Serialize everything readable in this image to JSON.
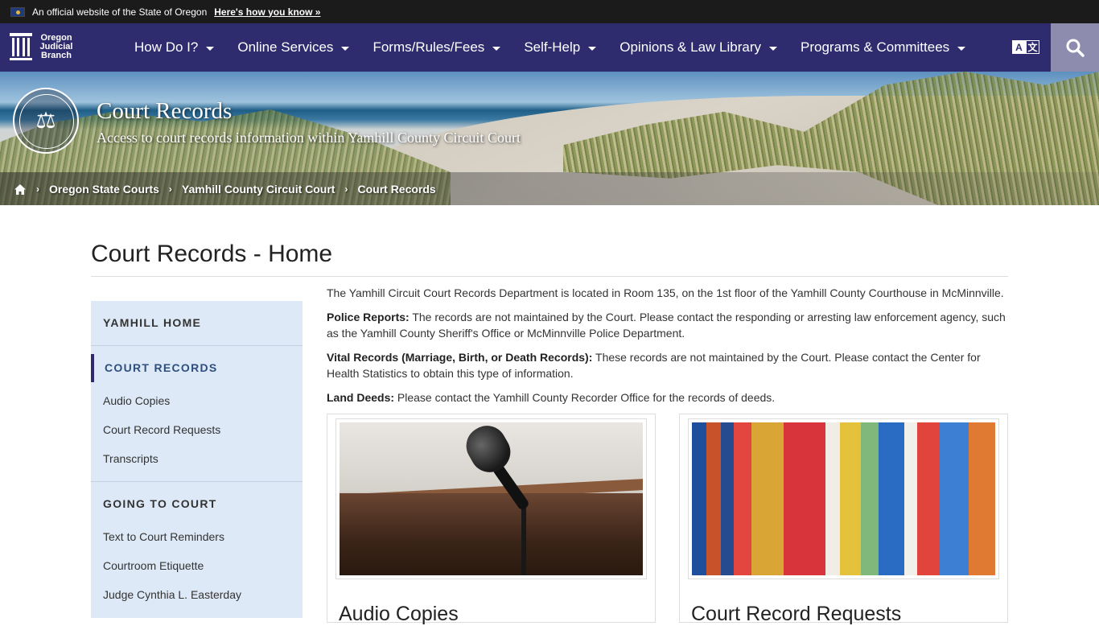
{
  "official_banner": {
    "text": "An official website of the State of Oregon",
    "link": "Here's how you know »"
  },
  "navbar": {
    "logo_lines": [
      "Oregon",
      "Judicial",
      "Branch"
    ],
    "items": [
      {
        "label": "How Do I?"
      },
      {
        "label": "Online Services"
      },
      {
        "label": "Forms/Rules/Fees"
      },
      {
        "label": "Self-Help"
      },
      {
        "label": "Opinions & Law Library"
      },
      {
        "label": "Programs & Committees"
      }
    ],
    "translate_glyphs": [
      "A",
      "文"
    ]
  },
  "hero": {
    "seal_symbol": "⚖",
    "title": "Court Records",
    "subtitle": "Access to court records information within Yamhill County Circuit Court",
    "breadcrumb": [
      "Oregon State Courts",
      "Yamhill County Circuit Court",
      "Court Records"
    ]
  },
  "page": {
    "title": "Court Records - Home"
  },
  "sidebar": {
    "sections": [
      {
        "heading": "YAMHILL HOME",
        "links": []
      },
      {
        "heading": "COURT RECORDS",
        "active": true,
        "links": [
          "Audio Copies",
          "Court Record Requests",
          "Transcripts"
        ]
      },
      {
        "heading": "GOING TO COURT",
        "links": [
          "Text to Court Reminders",
          "Courtroom Etiquette",
          "Judge Cynthia L. Easterday"
        ]
      }
    ]
  },
  "main": {
    "intro": "The Yamhill Circuit Court Records Department is located in Room 135, on the 1st floor of the Yamhill County Courthouse in McMinnville.",
    "police": {
      "label": "Police Reports:",
      "text": " The records are not maintained by the Court. Please contact the responding or arresting law enforcement agency, such as the Yamhill County Sheriff's Office or McMinnville Police Department."
    },
    "vital": {
      "label": "Vital Records (Marriage, Birth, or Death Records):",
      "text": " These records are not maintained by the Court. Please contact the Center for Health Statistics to obtain this type of information."
    },
    "land": {
      "label": "Land Deeds:",
      "text": " Please contact the Yamhill County Recorder Office for the records of deeds."
    }
  },
  "cards": [
    {
      "title": "Audio Copies"
    },
    {
      "title": "Court Record Requests"
    }
  ],
  "colors": {
    "navbar": "#2e2b6f",
    "sidebar": "#dde9f6",
    "search": "#8e8cae"
  }
}
